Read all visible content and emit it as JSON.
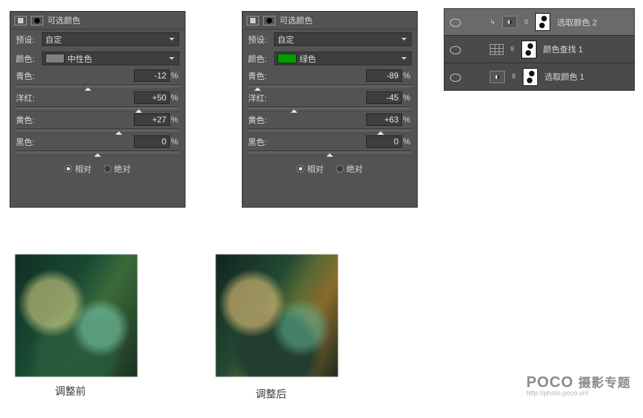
{
  "panel1": {
    "title": "可选颜色",
    "presetLabel": "预设:",
    "preset": "自定",
    "colorLabel": "颜色:",
    "colorName": "中性色",
    "swatch": "#808080",
    "sliders": [
      {
        "label": "青色:",
        "value": "-12",
        "thumb": 44
      },
      {
        "label": "洋红:",
        "value": "+50",
        "thumb": 75
      },
      {
        "label": "黄色:",
        "value": "+27",
        "thumb": 63
      },
      {
        "label": "黑色:",
        "value": "0",
        "thumb": 50
      }
    ],
    "pct": "%",
    "radio1": "相对",
    "radio2": "绝对"
  },
  "panel2": {
    "title": "可选颜色",
    "presetLabel": "预设:",
    "preset": "自定",
    "colorLabel": "颜色:",
    "colorName": "绿色",
    "swatch": "#00a000",
    "sliders": [
      {
        "label": "青色:",
        "value": "-89",
        "thumb": 6
      },
      {
        "label": "洋红:",
        "value": "-45",
        "thumb": 28
      },
      {
        "label": "黄色:",
        "value": "+63",
        "thumb": 81
      },
      {
        "label": "黑色:",
        "value": "0",
        "thumb": 50
      }
    ],
    "pct": "%",
    "radio1": "相对",
    "radio2": "绝对"
  },
  "layers": [
    {
      "name": "选取颜色 2",
      "selected": true,
      "kind": "sel-color",
      "clip": true
    },
    {
      "name": "颜色查找 1",
      "selected": false,
      "kind": "lut",
      "clip": false
    },
    {
      "name": "选取颜色 1",
      "selected": false,
      "kind": "sel-color",
      "clip": false
    }
  ],
  "captions": {
    "before": "调整前",
    "after": "调整后"
  },
  "watermark": {
    "brand": "POCO",
    "cn": "摄影专题",
    "url": "http://photo.poco.cn/"
  }
}
